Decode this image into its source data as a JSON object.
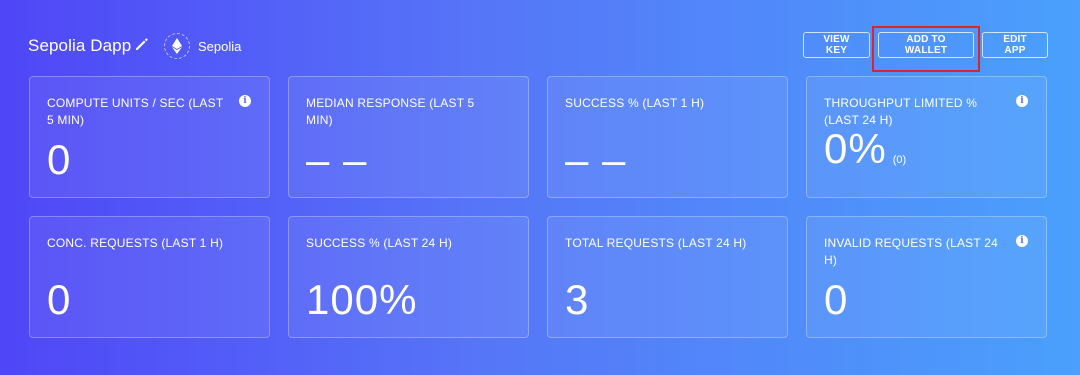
{
  "header": {
    "app_name": "Sepolia Dapp",
    "network_label": "Sepolia",
    "buttons": {
      "view_key": "VIEW KEY",
      "add_to_wallet": "ADD TO WALLET",
      "edit_app": "EDIT APP"
    }
  },
  "cards": [
    {
      "label": "COMPUTE UNITS / SEC (LAST 5 MIN)",
      "value": "0",
      "info": true
    },
    {
      "label": "MEDIAN RESPONSE (LAST 5 MIN)",
      "value": "– –",
      "info": false
    },
    {
      "label": "SUCCESS % (LAST 1 H)",
      "value": "– –",
      "info": false
    },
    {
      "label": "THROUGHPUT LIMITED % (LAST 24 H)",
      "value": "0%",
      "sub": "(0)",
      "info": true
    },
    {
      "label": "CONC. REQUESTS (LAST 1 H)",
      "value": "0",
      "info": false
    },
    {
      "label": "SUCCESS % (LAST 24 H)",
      "value": "100%",
      "info": false
    },
    {
      "label": "TOTAL REQUESTS (LAST 24 H)",
      "value": "3",
      "info": false
    },
    {
      "label": "INVALID REQUESTS (LAST 24 H)",
      "value": "0",
      "info": true
    }
  ],
  "icons": {
    "edit": "pencil-icon",
    "network": "ethereum-icon",
    "info": "info-icon"
  },
  "colors": {
    "gradient_start": "#4f46f7",
    "gradient_end": "#4aa0fc",
    "highlight": "#e0232a"
  }
}
